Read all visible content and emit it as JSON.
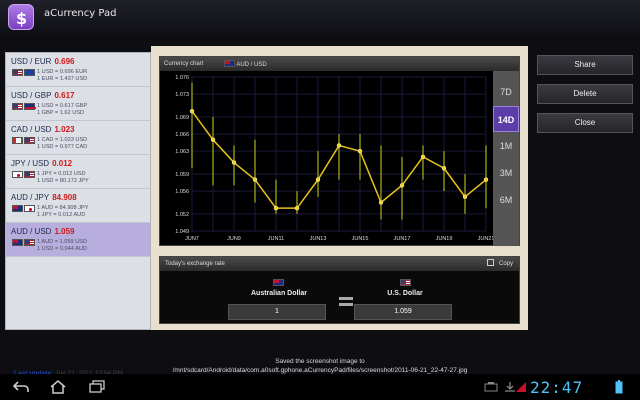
{
  "app": {
    "title": "aCurrency Pad"
  },
  "pairs": [
    {
      "name": "USD / EUR",
      "rate": "0.696",
      "line1": "1 USD = 0.696 EUR",
      "line2": "1 EUR = 1.437 USD",
      "flag1": "us",
      "flag2": "eu"
    },
    {
      "name": "USD / GBP",
      "rate": "0.617",
      "line1": "1 USD = 0.617 GBP",
      "line2": "1 GBP = 1.62 USD",
      "flag1": "us",
      "flag2": "gb"
    },
    {
      "name": "CAD / USD",
      "rate": "1.023",
      "line1": "1 CAD = 1.023 USD",
      "line2": "1 USD = 0.977 CAD",
      "flag1": "ca",
      "flag2": "us"
    },
    {
      "name": "JPY / USD",
      "rate": "0.012",
      "line1": "1 JPY = 0.012 USD",
      "line2": "1 USD = 80.172 JPY",
      "flag1": "jp",
      "flag2": "us"
    },
    {
      "name": "AUD / JPY",
      "rate": "84.908",
      "line1": "1 AUD = 84.908 JPY",
      "line2": "1 JPY = 0.012 AUD",
      "flag1": "au",
      "flag2": "jp"
    },
    {
      "name": "AUD / USD",
      "rate": "1.059",
      "line1": "1 AUD = 1.059 USD",
      "line2": "1 USD = 0.944 AUD",
      "flag1": "au",
      "flag2": "us",
      "selected": true
    }
  ],
  "last_update": {
    "label": "Last update:",
    "value": "Jun 21, 2011 10:04 PM"
  },
  "chart": {
    "title": "Currency chart",
    "pair_label": "AUD / USD",
    "ranges": [
      "7D",
      "14D",
      "1M",
      "3M",
      "6M"
    ],
    "active_range": "14D"
  },
  "chart_data": {
    "type": "line",
    "title": "",
    "x": [
      "JUN7",
      "JUN8",
      "JUN9",
      "JUN10",
      "JUN11",
      "JUN12",
      "JUN13",
      "JUN14",
      "JUN15",
      "JUN16",
      "JUN17",
      "JUN18",
      "JUN19",
      "JUN20",
      "JUN21"
    ],
    "x_tick_labels": [
      "JUN7",
      "JUN9",
      "JUN11",
      "JUN13",
      "JUN15",
      "JUN17",
      "JUN19",
      "JUN21"
    ],
    "y_tick_labels": [
      "1.049",
      "1.052",
      "1.056",
      "1.059",
      "1.063",
      "1.066",
      "1.069",
      "1.073",
      "1.076"
    ],
    "series": [
      {
        "values": [
          1.07,
          1.065,
          1.061,
          1.058,
          1.053,
          1.053,
          1.058,
          1.064,
          1.063,
          1.054,
          1.057,
          1.062,
          1.06,
          1.055,
          1.058
        ]
      }
    ],
    "ranges": [
      [
        1.06,
        1.075
      ],
      [
        1.057,
        1.069
      ],
      [
        1.057,
        1.064
      ],
      [
        1.054,
        1.065
      ],
      [
        1.052,
        1.058
      ],
      [
        1.052,
        1.056
      ],
      [
        1.055,
        1.063
      ],
      [
        1.058,
        1.066
      ],
      [
        1.058,
        1.066
      ],
      [
        1.051,
        1.064
      ],
      [
        1.051,
        1.062
      ],
      [
        1.058,
        1.064
      ],
      [
        1.056,
        1.063
      ],
      [
        1.052,
        1.059
      ],
      [
        1.053,
        1.064
      ]
    ],
    "ylim": [
      1.049,
      1.076
    ],
    "grid": true,
    "colors": {
      "line": "#e8c21a",
      "range": "#8c8c12",
      "marker": "#f2d21a",
      "grid": "#1a1a3a"
    }
  },
  "exchange": {
    "title": "Today's exchange rate",
    "copy_label": "Copy",
    "from_name": "Australian Dollar",
    "from_value": "1",
    "to_name": "U.S. Dollar",
    "to_value": "1.059"
  },
  "actions": {
    "share": "Share",
    "delete": "Delete",
    "close": "Close"
  },
  "toast": {
    "line1": "Saved the screenshot image to",
    "line2": "/mnt/sdcard/Android/data/com.a0soft.gphone.aCurrencyPad/files/screenshot/2011-06-21_22-47-27.jpg"
  },
  "status": {
    "clock": "22:47"
  }
}
